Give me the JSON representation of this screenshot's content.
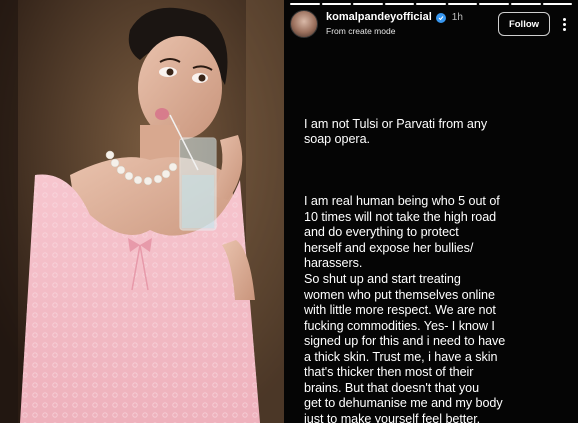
{
  "story": {
    "username": "komalpandeyofficial",
    "time_ago": "1h",
    "subtitle": "From create mode",
    "follow_label": "Follow",
    "progress": {
      "segments": 9,
      "completed": 9
    },
    "paragraph_1": "I am not Tulsi or Parvati from any\nsoap opera.",
    "paragraph_2": "I am real human being who 5 out of\n10 times will not take the high road\nand do everything to protect\nherself and expose her bullies/\nharassers.\nSo shut up and start treating\nwomen who put themselves online\nwith little more respect. We are not\nfucking commodities. Yes- I know I\nsigned up for this and i need to have\na thick skin. Trust me, i have a skin\nthat's thicker then most of their\nbrains. But that doesn't that you\nget to dehumanise me and my body\njust to make yourself feel better."
  },
  "colors": {
    "story_background": "#050505",
    "text": "#ffffff",
    "verified_badge": "#3897f0",
    "dress": "#f4b7c3"
  },
  "photo": {
    "subject": "woman in pink lace outfit with pearl necklace drinking from a glass"
  }
}
